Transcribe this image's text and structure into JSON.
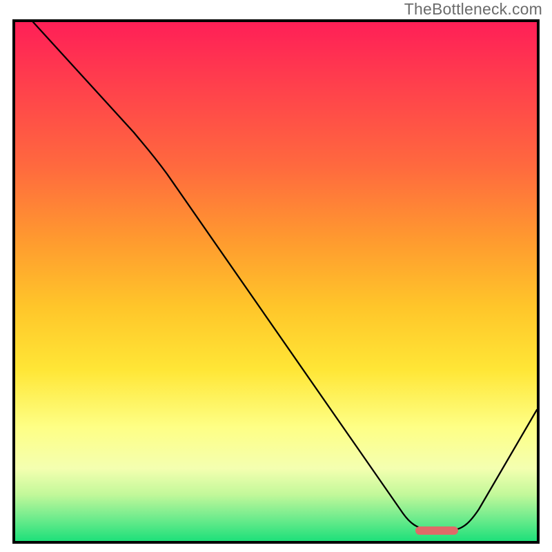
{
  "attribution": "TheBottleneck.com",
  "colors": {
    "curve": "#000000",
    "marker": "#df6b68",
    "frame": "#000000",
    "gradient_top": "#ff1f57",
    "gradient_bottom": "#1ee07a"
  },
  "chart_data": {
    "type": "line",
    "title": "",
    "xlabel": "",
    "ylabel": "",
    "xlim": [
      0,
      100
    ],
    "ylim": [
      0,
      100
    ],
    "x": [
      3,
      23,
      29,
      74,
      79,
      84,
      100
    ],
    "y": [
      100,
      79,
      71,
      5,
      2,
      2,
      25
    ],
    "series": [
      {
        "name": "bottleneck-curve",
        "x": [
          3,
          23,
          29,
          74,
          79,
          84,
          100
        ],
        "y": [
          100,
          79,
          71,
          5,
          2,
          2,
          25
        ]
      }
    ],
    "annotations": [
      {
        "name": "optimal-range-marker",
        "x_range": [
          77,
          85
        ],
        "y": 2,
        "color": "#df6b68"
      }
    ],
    "background": {
      "type": "vertical-gradient",
      "stops": [
        {
          "pos": 0.0,
          "color": "#ff1f57"
        },
        {
          "pos": 0.1,
          "color": "#ff3a4e"
        },
        {
          "pos": 0.28,
          "color": "#ff6a3e"
        },
        {
          "pos": 0.42,
          "color": "#ff9a2f"
        },
        {
          "pos": 0.55,
          "color": "#ffc62a"
        },
        {
          "pos": 0.67,
          "color": "#ffe636"
        },
        {
          "pos": 0.78,
          "color": "#feff85"
        },
        {
          "pos": 0.86,
          "color": "#f4ffb0"
        },
        {
          "pos": 0.91,
          "color": "#c3f89a"
        },
        {
          "pos": 0.95,
          "color": "#7aed8f"
        },
        {
          "pos": 1.0,
          "color": "#1ee07a"
        }
      ]
    }
  }
}
